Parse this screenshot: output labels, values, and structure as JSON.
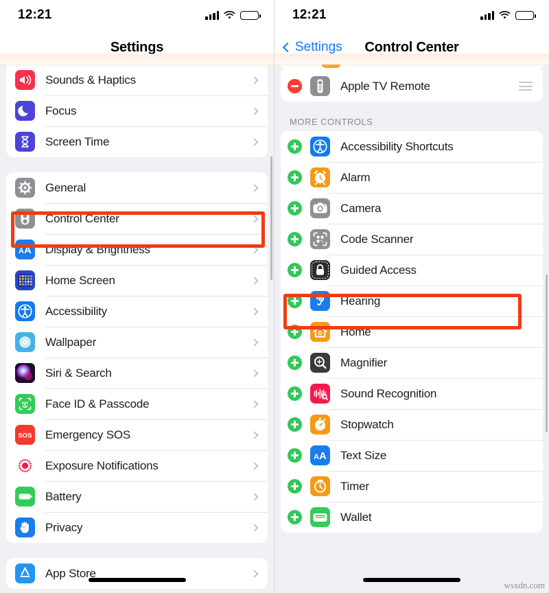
{
  "watermark": "wsxdn.com",
  "colors": {
    "accent_blue": "#0a7cf3",
    "highlight_red": "#f03c14",
    "add_green": "#34c759",
    "remove_red": "#ff3b30",
    "battery_yellow": "#f7cf3f"
  },
  "left": {
    "status": {
      "time": "12:21",
      "battery_level": "50"
    },
    "nav": {
      "title": "Settings"
    },
    "group1": [
      {
        "label": "Sounds & Haptics",
        "icon": "speaker-waves-icon",
        "icon_bg": "#f8304a"
      },
      {
        "label": "Focus",
        "icon": "moon-icon",
        "icon_bg": "#4b44d6"
      },
      {
        "label": "Screen Time",
        "icon": "hourglass-icon",
        "icon_bg": "#4b44d6"
      }
    ],
    "group2": [
      {
        "label": "General",
        "icon": "gear-icon",
        "icon_bg": "#8e8e93"
      },
      {
        "label": "Control Center",
        "icon": "control-center-toggles-icon",
        "icon_bg": "#8e8e93"
      },
      {
        "label": "Display & Brightness",
        "icon": "text-size-aa-icon",
        "icon_bg": "#1a7ced"
      },
      {
        "label": "Home Screen",
        "icon": "app-grid-icon",
        "icon_bg": "#2c43c8"
      },
      {
        "label": "Accessibility",
        "icon": "accessibility-person-icon",
        "icon_bg": "#137aed"
      },
      {
        "label": "Wallpaper",
        "icon": "flower-icon",
        "icon_bg": "#46b2e8"
      },
      {
        "label": "Siri & Search",
        "icon": "siri-orb-icon",
        "icon_bg": "#2a1a3a"
      },
      {
        "label": "Face ID & Passcode",
        "icon": "face-id-icon",
        "icon_bg": "#32cc58"
      },
      {
        "label": "Emergency SOS",
        "icon": "sos-icon",
        "icon_bg": "#f43a2e"
      },
      {
        "label": "Exposure Notifications",
        "icon": "exposure-dots-icon",
        "icon_bg": "#ffffff"
      },
      {
        "label": "Battery",
        "icon": "battery-icon",
        "icon_bg": "#32cc58"
      },
      {
        "label": "Privacy",
        "icon": "hand-raised-icon",
        "icon_bg": "#1a7ced"
      }
    ],
    "group3": [
      {
        "label": "App Store",
        "icon": "app-store-icon",
        "icon_bg": "#2196f3"
      }
    ],
    "highlight_label": "Control Center"
  },
  "right": {
    "status": {
      "time": "12:21",
      "battery_level": "50"
    },
    "nav": {
      "back_label": "Settings",
      "title": "Control Center"
    },
    "included": [
      {
        "label": "Apple TV Remote",
        "icon": "apple-tv-remote-icon",
        "icon_bg": "#8e8e93",
        "action": "remove"
      }
    ],
    "section_header": "MORE CONTROLS",
    "more_controls": [
      {
        "label": "Accessibility Shortcuts",
        "icon": "accessibility-person-icon",
        "icon_bg": "#137aed"
      },
      {
        "label": "Alarm",
        "icon": "alarm-clock-icon",
        "icon_bg": "#f59a15"
      },
      {
        "label": "Camera",
        "icon": "camera-icon",
        "icon_bg": "#8e8e93"
      },
      {
        "label": "Code Scanner",
        "icon": "qr-code-scanner-icon",
        "icon_bg": "#8e8e93"
      },
      {
        "label": "Guided Access",
        "icon": "lock-icon",
        "icon_bg": "#2c2c2e"
      },
      {
        "label": "Hearing",
        "icon": "ear-icon",
        "icon_bg": "#1a7ced"
      },
      {
        "label": "Home",
        "icon": "house-icon",
        "icon_bg": "#f59a15"
      },
      {
        "label": "Magnifier",
        "icon": "magnifier-icon",
        "icon_bg": "#3a3a3c"
      },
      {
        "label": "Sound Recognition",
        "icon": "sound-waveform-icon",
        "icon_bg": "#f5194f"
      },
      {
        "label": "Stopwatch",
        "icon": "stopwatch-icon",
        "icon_bg": "#f59a15"
      },
      {
        "label": "Text Size",
        "icon": "text-size-aa-icon",
        "icon_bg": "#1a7ced"
      },
      {
        "label": "Timer",
        "icon": "timer-icon",
        "icon_bg": "#f59a15"
      },
      {
        "label": "Wallet",
        "icon": "wallet-icon",
        "icon_bg": "#32cc58"
      }
    ],
    "highlight_label": "Hearing"
  }
}
